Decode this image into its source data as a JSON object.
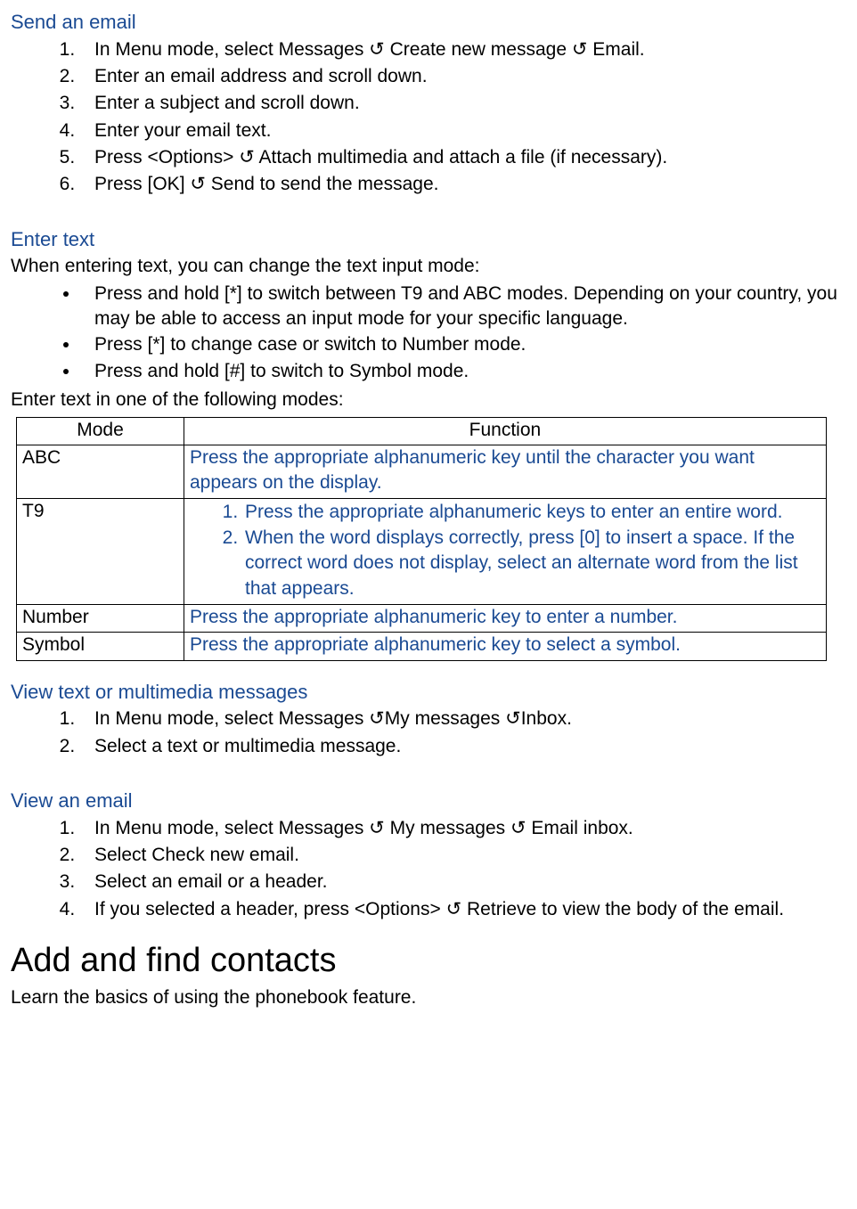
{
  "arrow": "↺",
  "sec1": {
    "title": "Send an email",
    "steps": [
      "In Menu mode, select Messages ↺ Create new message ↺ Email.",
      "Enter an email address and scroll down.",
      "Enter a subject and scroll down.",
      "Enter your email text.",
      "Press <Options> ↺ Attach multimedia and attach a file (if necessary).",
      "Press [OK] ↺ Send to send the message."
    ]
  },
  "sec2": {
    "title": "Enter text",
    "intro": "When entering text, you can change the text input mode:",
    "bullets": [
      "Press and hold [*] to switch between T9 and ABC modes. Depending on your country, you may be able to access an input mode for your specific language.",
      "Press [*] to change case or switch to Number mode.",
      "Press and hold [#] to switch to Symbol mode."
    ],
    "outro": "Enter text in one of the following modes:"
  },
  "table": {
    "head_mode": "Mode",
    "head_func": "Function",
    "abc_label": "ABC",
    "abc_func": "Press the appropriate alphanumeric key until the character you want appears on the display.",
    "t9_label": "T9",
    "t9_steps": [
      "Press the appropriate alphanumeric keys to enter an entire word.",
      "When the word displays correctly, press [0] to insert a space. If the correct word does not display, select an alternate word from the list that appears."
    ],
    "num_label": "Number",
    "num_func": "Press the appropriate alphanumeric key to enter a number.",
    "sym_label": "Symbol",
    "sym_func": "Press the appropriate alphanumeric key to select a symbol."
  },
  "sec3": {
    "title": "View text or multimedia messages",
    "steps": [
      "In Menu mode, select Messages ↺My messages ↺Inbox.",
      "Select a text or multimedia message."
    ]
  },
  "sec4": {
    "title": "View an email",
    "steps": [
      "In Menu mode, select Messages ↺ My messages ↺ Email inbox.",
      "Select Check new email.",
      "Select an email or a header.",
      "If you selected a header, press <Options> ↺ Retrieve to view the body of the email."
    ]
  },
  "h1": "Add and find contacts",
  "h1_sub": "Learn the basics of using the phonebook feature."
}
